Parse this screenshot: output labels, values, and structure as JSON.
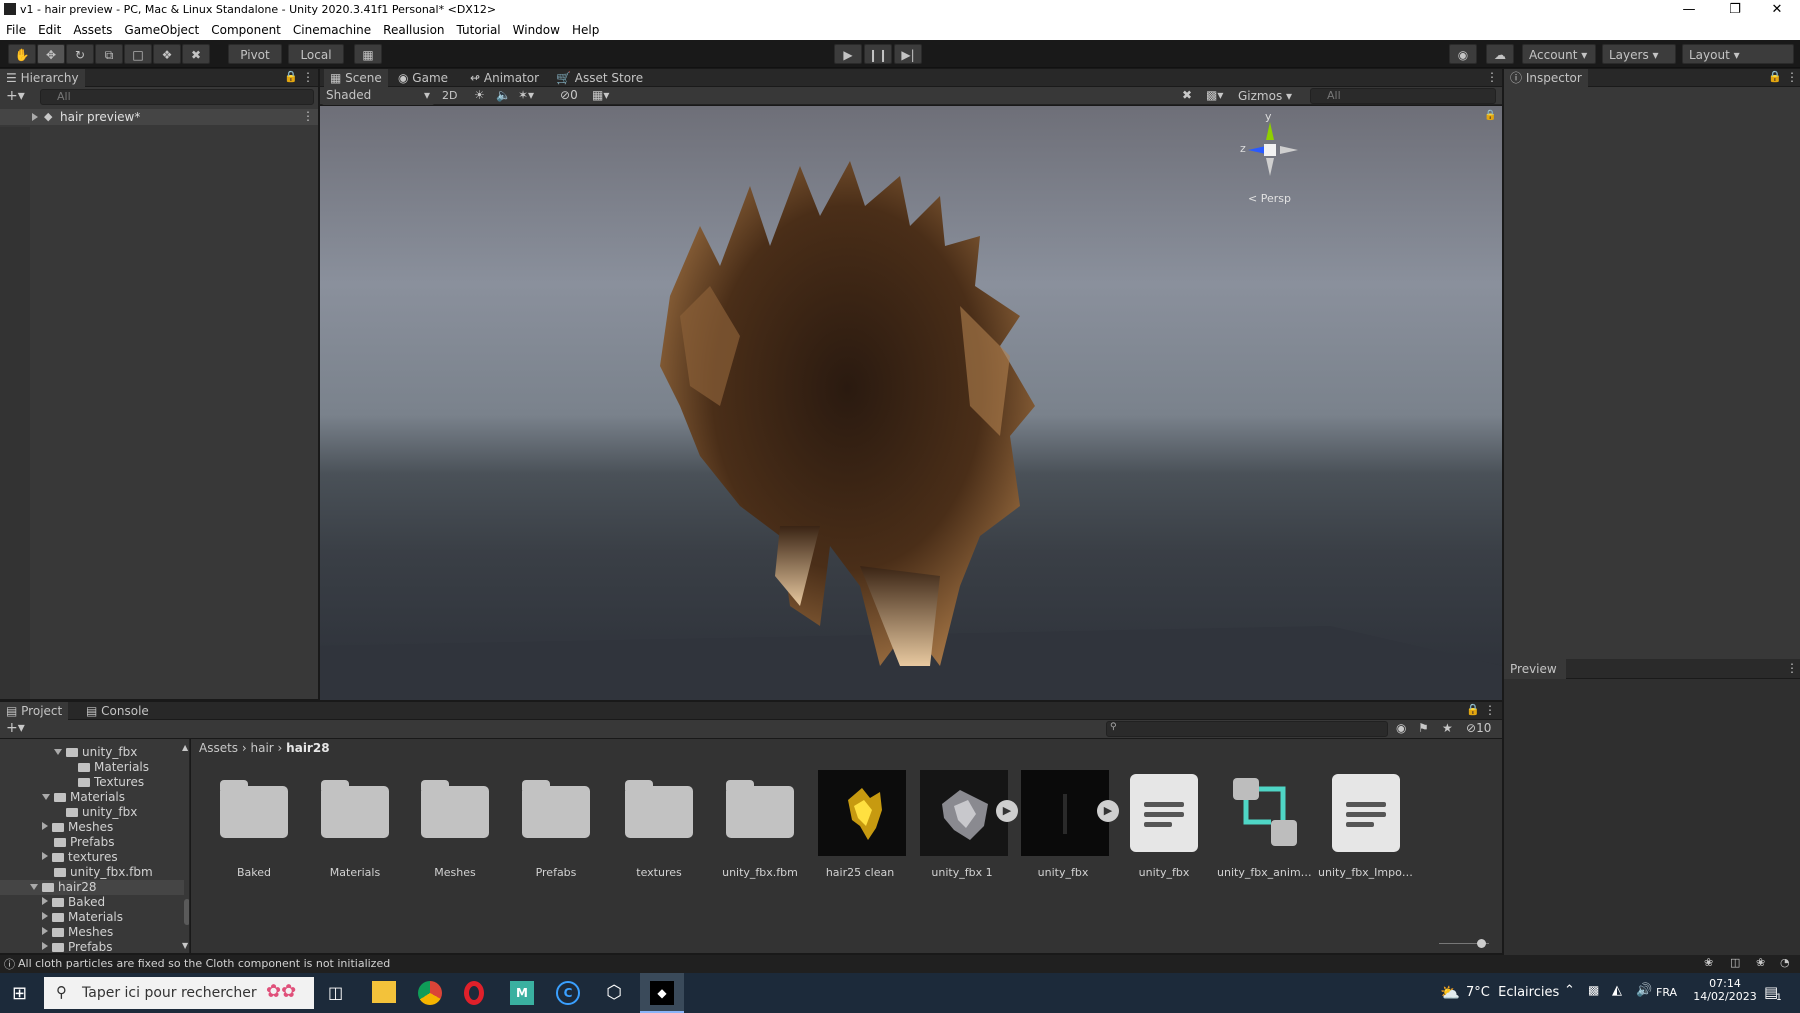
{
  "window": {
    "title": "v1 - hair preview - PC, Mac & Linux Standalone - Unity 2020.3.41f1 Personal* <DX12>"
  },
  "menu": [
    "File",
    "Edit",
    "Assets",
    "GameObject",
    "Component",
    "Cinemachine",
    "Reallusion",
    "Tutorial",
    "Window",
    "Help"
  ],
  "toolbar": {
    "pivot_label": "Pivot",
    "local_label": "Local",
    "account_label": "Account",
    "layers_label": "Layers",
    "layout_label": "Layout"
  },
  "hierarchy": {
    "tab_label": "Hierarchy",
    "search_placeholder": "All",
    "scene_item": "hair preview*"
  },
  "scene_view": {
    "tabs": [
      "Scene",
      "Game",
      "Animator",
      "Asset Store"
    ],
    "active_tab": "Scene",
    "shading_mode": "Shaded",
    "mode_2d": "2D",
    "hidden_count": "0",
    "gizmos_label": "Gizmos",
    "search_placeholder": "All",
    "persp_label": "< Persp",
    "gizmo_axes": {
      "y": "y",
      "z": "z"
    },
    "colors": {
      "sky_top": "#6f6f78",
      "sky_mid": "#8c93a0",
      "horizon": "#4a5056",
      "ground": "#2b2f36",
      "hair_dark": "#2a1a10",
      "hair_light": "#c79a66"
    }
  },
  "inspector": {
    "tab_label": "Inspector",
    "preview_label": "Preview"
  },
  "project": {
    "tabs": [
      "Project",
      "Console"
    ],
    "active_tab": "Project",
    "hidden_count": "10",
    "breadcrumb": [
      "Assets",
      "hair",
      "hair28"
    ],
    "tree": [
      {
        "label": "unity_fbx",
        "depth": 1,
        "expanded": true
      },
      {
        "label": "Materials",
        "depth": 2
      },
      {
        "label": "Textures",
        "depth": 2
      },
      {
        "label": "Materials",
        "depth": 0,
        "expanded": true
      },
      {
        "label": "unity_fbx",
        "depth": 1
      },
      {
        "label": "Meshes",
        "depth": 0,
        "collapsed": true
      },
      {
        "label": "Prefabs",
        "depth": 0
      },
      {
        "label": "textures",
        "depth": 0,
        "collapsed": true
      },
      {
        "label": "unity_fbx.fbm",
        "depth": 0
      },
      {
        "label": "hair28",
        "depth": -1,
        "expanded": true,
        "selected": true
      },
      {
        "label": "Baked",
        "depth": 0,
        "collapsed": true
      },
      {
        "label": "Materials",
        "depth": 0,
        "collapsed": true
      },
      {
        "label": "Meshes",
        "depth": 0,
        "collapsed": true
      },
      {
        "label": "Prefabs",
        "depth": 0,
        "collapsed": true
      }
    ],
    "assets": [
      {
        "label": "Baked",
        "kind": "folder"
      },
      {
        "label": "Materials",
        "kind": "folder"
      },
      {
        "label": "Meshes",
        "kind": "folder"
      },
      {
        "label": "Prefabs",
        "kind": "folder"
      },
      {
        "label": "textures",
        "kind": "folder"
      },
      {
        "label": "unity_fbx.fbm",
        "kind": "folder"
      },
      {
        "label": "hair25 clean",
        "kind": "material"
      },
      {
        "label": "unity_fbx 1",
        "kind": "model"
      },
      {
        "label": "unity_fbx",
        "kind": "model"
      },
      {
        "label": "unity_fbx",
        "kind": "document"
      },
      {
        "label": "unity_fbx_animat...",
        "kind": "animator"
      },
      {
        "label": "unity_fbx_Importi...",
        "kind": "document"
      }
    ]
  },
  "status_bar": {
    "message": "All cloth particles are fixed so the Cloth component is not initialized"
  },
  "taskbar": {
    "search_placeholder": "Taper ici pour rechercher",
    "weather": "7°C  Eclaircies",
    "language": "FRA",
    "time": "07:14",
    "date": "14/02/2023",
    "notification_count": "1"
  }
}
